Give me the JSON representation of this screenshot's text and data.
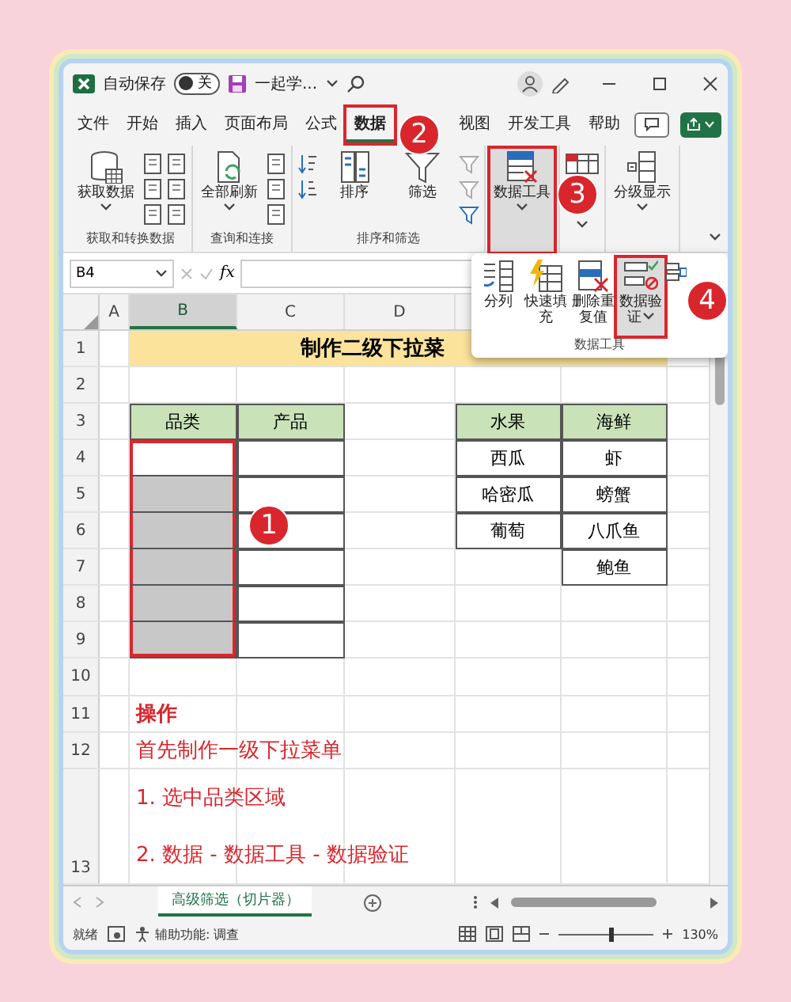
{
  "title_bar": {
    "autosave_label": "自动保存",
    "autosave": {
      "on": false,
      "label": "关"
    },
    "file_name": "一起学..."
  },
  "tabs": [
    {
      "label": "文件",
      "selected": false,
      "highlighted": false
    },
    {
      "label": "开始",
      "selected": false,
      "highlighted": false
    },
    {
      "label": "插入",
      "selected": false,
      "highlighted": false
    },
    {
      "label": "页面布局",
      "selected": false,
      "highlighted": false
    },
    {
      "label": "公式",
      "selected": false,
      "highlighted": false
    },
    {
      "label": "数据",
      "selected": true,
      "highlighted": true
    },
    {
      "label": "视图",
      "selected": false,
      "highlighted": false
    },
    {
      "label": "开发工具",
      "selected": false,
      "highlighted": false
    },
    {
      "label": "帮助",
      "selected": false,
      "highlighted": false
    }
  ],
  "ribbon": {
    "groups": [
      {
        "kind": "get",
        "label": "获取和转换数据",
        "buttons": [
          {
            "label": "获取数据",
            "highlighted": false
          }
        ]
      },
      {
        "kind": "queries",
        "label": "查询和连接",
        "buttons": [
          {
            "label": "全部刷新",
            "highlighted": false
          }
        ]
      },
      {
        "kind": "sort",
        "label": "排序和筛选",
        "buttons": [
          {
            "label": "排序",
            "highlighted": false
          },
          {
            "label": "筛选",
            "highlighted": false
          }
        ]
      },
      {
        "kind": "tools",
        "buttons": [
          {
            "label": "数据工具",
            "highlighted": true
          }
        ]
      },
      {
        "kind": "forecast"
      },
      {
        "kind": "outline",
        "buttons": [
          {
            "label": "分级显示",
            "highlighted": false
          }
        ]
      }
    ]
  },
  "popup": {
    "label": "数据工具",
    "buttons": [
      {
        "kind": "split",
        "label": "分列",
        "highlighted": false
      },
      {
        "kind": "fill",
        "label": "快速填充",
        "highlighted": false
      },
      {
        "kind": "dedupe",
        "label": "删除重复值",
        "highlighted": false
      },
      {
        "kind": "validate",
        "label": "数据验证",
        "highlighted": true
      }
    ]
  },
  "callouts": [
    "1",
    "2",
    "3",
    "4"
  ],
  "formula_bar": {
    "name_box": "B4",
    "function_label": "fx"
  },
  "sheet": {
    "columns": [
      {
        "label": "A",
        "selected": false
      },
      {
        "label": "B",
        "selected": true
      },
      {
        "label": "C",
        "selected": false
      },
      {
        "label": "D",
        "selected": false
      }
    ],
    "rows": [
      {
        "number": "1",
        "kind": "title",
        "text": "制作二级下拉菜"
      },
      {
        "number": "2",
        "kind": "blank"
      },
      {
        "number": "3",
        "kind": "grid",
        "cells": [
          {
            "kind": "blank"
          },
          {
            "kind": "header",
            "text": "品类"
          },
          {
            "kind": "header",
            "text": "产品"
          },
          {
            "kind": "blank"
          },
          {
            "kind": "header",
            "text": "水果"
          },
          {
            "kind": "header",
            "text": "海鲜"
          }
        ]
      },
      {
        "number": "4",
        "kind": "grid",
        "cells": [
          {
            "kind": "blank"
          },
          {
            "kind": "box",
            "outlined": true
          },
          {
            "kind": "box"
          },
          {
            "kind": "blank"
          },
          {
            "kind": "value",
            "text": "西瓜"
          },
          {
            "kind": "value",
            "text": "虾"
          }
        ]
      },
      {
        "number": "5",
        "kind": "grid",
        "cells": [
          {
            "kind": "blank"
          },
          {
            "kind": "shaded",
            "outlined": true
          },
          {
            "kind": "box"
          },
          {
            "kind": "blank"
          },
          {
            "kind": "value",
            "text": "哈密瓜"
          },
          {
            "kind": "value",
            "text": "螃蟹"
          }
        ]
      },
      {
        "number": "6",
        "kind": "grid",
        "cells": [
          {
            "kind": "blank"
          },
          {
            "kind": "shaded",
            "outlined": true
          },
          {
            "kind": "box"
          },
          {
            "kind": "blank"
          },
          {
            "kind": "value",
            "text": "葡萄"
          },
          {
            "kind": "value",
            "text": "八爪鱼"
          }
        ]
      },
      {
        "number": "7",
        "kind": "grid",
        "cells": [
          {
            "kind": "blank"
          },
          {
            "kind": "shaded",
            "outlined": true
          },
          {
            "kind": "box"
          },
          {
            "kind": "blank"
          },
          {
            "kind": "blank"
          },
          {
            "kind": "value",
            "text": "鲍鱼"
          }
        ]
      },
      {
        "number": "8",
        "kind": "grid",
        "cells": [
          {
            "kind": "blank"
          },
          {
            "kind": "shaded",
            "outlined": true
          },
          {
            "kind": "box"
          },
          {
            "kind": "blank"
          },
          {
            "kind": "blank"
          },
          {
            "kind": "blank"
          }
        ]
      },
      {
        "number": "9",
        "kind": "grid",
        "cells": [
          {
            "kind": "blank"
          },
          {
            "kind": "shaded",
            "outlined": true
          },
          {
            "kind": "box"
          },
          {
            "kind": "blank"
          },
          {
            "kind": "blank"
          },
          {
            "kind": "blank"
          }
        ]
      },
      {
        "number": "10",
        "kind": "blank"
      },
      {
        "number": "11",
        "kind": "note",
        "lines": [
          {
            "text": "操作",
            "bold": true
          }
        ]
      },
      {
        "number": "12",
        "kind": "note",
        "lines": [
          {
            "text": "首先制作一级下拉菜单",
            "bold": false
          }
        ]
      },
      {
        "number": "13",
        "kind": "note",
        "lines": [
          {
            "text": "1. 选中品类区域",
            "bold": false
          },
          {
            "text": "2. 数据 - 数据工具 - 数据验证",
            "bold": false
          }
        ]
      }
    ]
  },
  "sheet_tabs": [
    {
      "label": "高级筛选（切片器）",
      "selected": true
    }
  ],
  "status_bar": {
    "ready": "就绪",
    "accessibility": "辅助功能: 调查",
    "zoom": {
      "level": 0.55,
      "label": "130%"
    }
  }
}
